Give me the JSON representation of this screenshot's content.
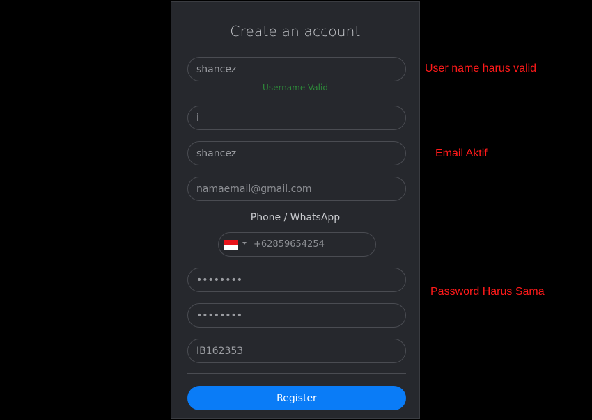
{
  "form": {
    "title": "Create an account",
    "username": {
      "value": "shancez",
      "hint": "Username Valid",
      "hint_color": "#2e8b3a"
    },
    "field2": {
      "value": "i"
    },
    "field3": {
      "value": "shancez"
    },
    "email": {
      "placeholder": "namaemail@gmail.com"
    },
    "phone": {
      "label": "Phone / WhatsApp",
      "country_flag": "indonesia-flag-icon",
      "placeholder": "+62859654254"
    },
    "password": {
      "value": "••••••••"
    },
    "password_confirm": {
      "value": "••••••••"
    },
    "referral": {
      "value": "IB162353"
    },
    "register_label": "Register",
    "accent_color": "#0a7cf7"
  },
  "annotations": {
    "username_note": "User name harus valid",
    "email_note": "Email Aktif",
    "password_note": "Password Harus Sama",
    "color": "#ff1a1a"
  }
}
